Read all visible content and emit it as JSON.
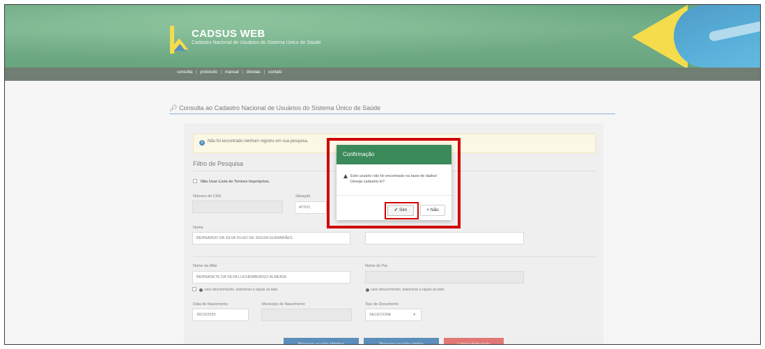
{
  "header": {
    "title": "CADSUS WEB",
    "subtitle": "Cadastro Nacional de Usuários do Sistema Único de Saúde"
  },
  "nav": {
    "items": [
      "consulta",
      "protocolo",
      "manual",
      "dúvidas",
      "contato"
    ],
    "separator": "|"
  },
  "page": {
    "title": "Consulta ao Cadastro Nacional de Usuários do Sistema Único de Saúde"
  },
  "alert": {
    "icon": "info-icon",
    "text": "Não foi encontrado nenhum registro em sua pesquisa."
  },
  "filter": {
    "title": "Filtro de Pesquisa",
    "checkbox_label": "Não Usar Lista de Termos Impróprios.",
    "cns_label": "Número do CNS",
    "cns_value": "",
    "situacao_label": "Situação",
    "situacao_value": "ATIVO",
    "nome_label": "Nome",
    "nome_value": "BERNARDO DA SILVA FILHO DE SOUZA GUIMARÃES",
    "nome_social_label": "Nome Social",
    "nome_social_value": "",
    "mae_label": "Nome da Mãe",
    "mae_value": "BERNADETE DA SILVA LUCHEMBURGO ALMEIDA",
    "mae_hint": "caso desconhecido, selecionar a opção ao lado",
    "pai_label": "Nome do Pai",
    "pai_value": "",
    "pai_hint": "caso desconhecido, selecionar a opção ao lado",
    "nascimento_label": "Data de Nascimento",
    "nascimento_value": "28/12/2025",
    "municipio_label": "Município de Nascimento",
    "municipio_value": "",
    "tipo_doc_label": "Tipo de Documento",
    "tipo_doc_value": "SELECIONE"
  },
  "actions": {
    "identicos": "Procurar usuário idêntico",
    "similar": "Procurar usuário similar",
    "limpar": "Limpar formulário"
  },
  "modal": {
    "title": "Confirmação",
    "message": "Este usuário não foi encontrado na base de dados! Deseja cadastrá-lo?",
    "yes_label": "Sim",
    "no_label": "Não",
    "yes_icon": "check-icon",
    "no_icon": "times-icon"
  },
  "colors": {
    "header_green": "#3a8a5a",
    "primary_blue": "#2f6fa8",
    "danger_red": "#d9534f",
    "highlight_red": "#d10000"
  }
}
